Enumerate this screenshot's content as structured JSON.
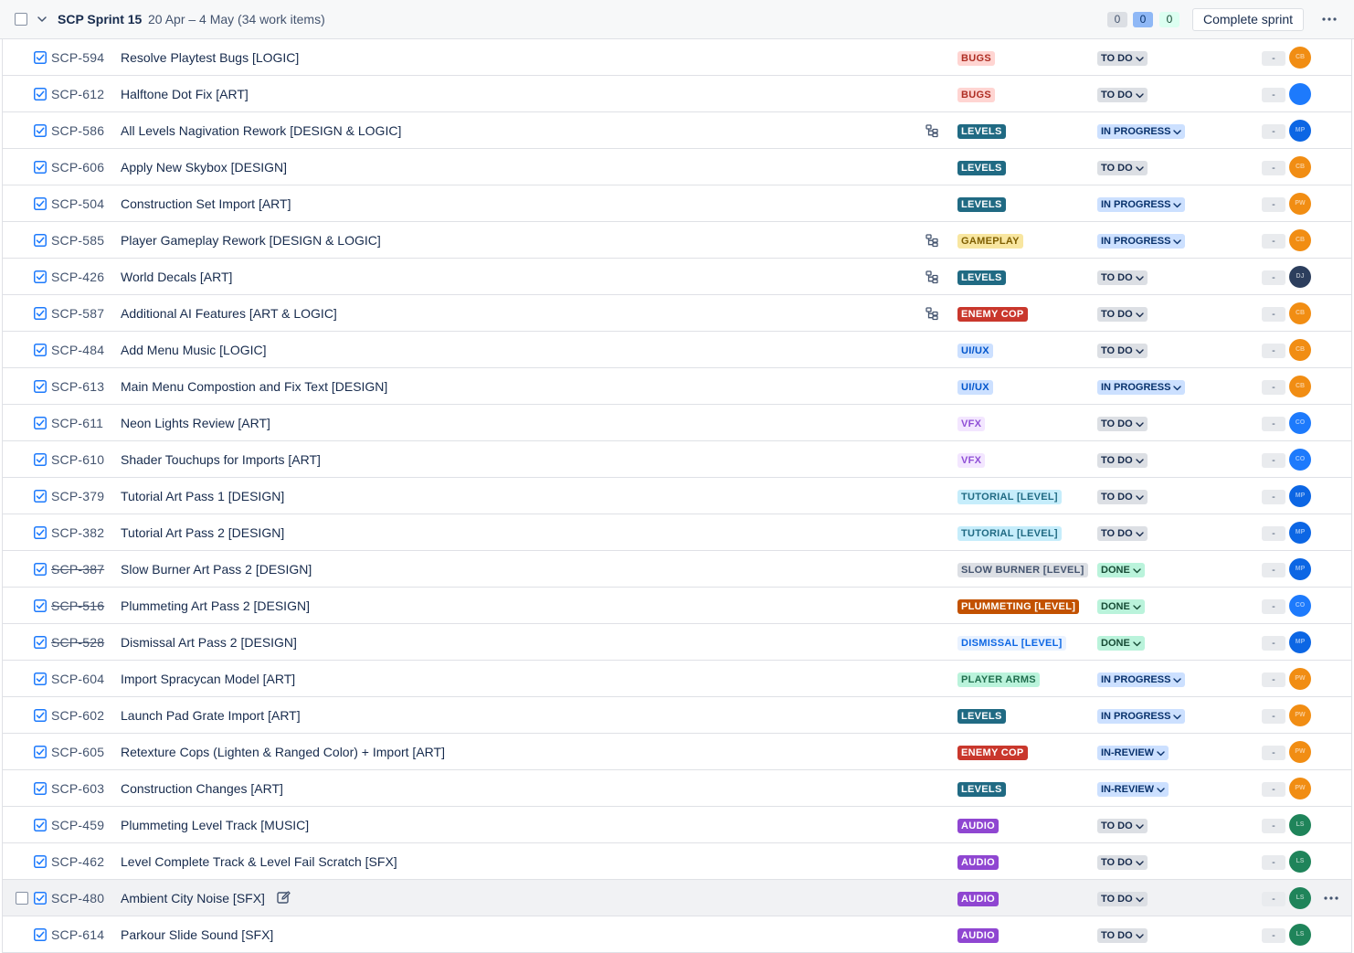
{
  "sprint": {
    "title": "SCP Sprint 15",
    "dates": "20 Apr – 4 May (34 work items)",
    "counts": {
      "todo": "0",
      "in_progress": "0",
      "done": "0"
    },
    "complete_label": "Complete sprint"
  },
  "issues": [
    {
      "key": "SCP-594",
      "summary": "Resolve Playtest Bugs [LOGIC]",
      "epic": "BUGS",
      "epic_style": "bugs",
      "status": "TO DO",
      "status_style": "todo",
      "estimate": "-",
      "avatar_color": "#f18d13",
      "avatar_text": "CB",
      "has_children": false,
      "done": false
    },
    {
      "key": "SCP-612",
      "summary": "Halftone Dot Fix [ART]",
      "epic": "BUGS",
      "epic_style": "bugs",
      "status": "TO DO",
      "status_style": "todo",
      "estimate": "-",
      "avatar_color": "#1d7afc",
      "avatar_text": "",
      "has_children": false,
      "done": false
    },
    {
      "key": "SCP-586",
      "summary": "All Levels Nagivation Rework [DESIGN & LOGIC]",
      "epic": "LEVELS",
      "epic_style": "levels",
      "status": "IN PROGRESS",
      "status_style": "progress",
      "estimate": "-",
      "avatar_color": "#0c66e4",
      "avatar_text": "MP",
      "has_children": true,
      "done": false
    },
    {
      "key": "SCP-606",
      "summary": "Apply New Skybox [DESIGN]",
      "epic": "LEVELS",
      "epic_style": "levels",
      "status": "TO DO",
      "status_style": "todo",
      "estimate": "-",
      "avatar_color": "#f18d13",
      "avatar_text": "CB",
      "has_children": false,
      "done": false
    },
    {
      "key": "SCP-504",
      "summary": "Construction Set Import [ART]",
      "epic": "LEVELS",
      "epic_style": "levels",
      "status": "IN PROGRESS",
      "status_style": "progress",
      "estimate": "-",
      "avatar_color": "#f18d13",
      "avatar_text": "PW",
      "has_children": false,
      "done": false
    },
    {
      "key": "SCP-585",
      "summary": "Player Gameplay Rework [DESIGN & LOGIC]",
      "epic": "GAMEPLAY",
      "epic_style": "gameplay",
      "status": "IN PROGRESS",
      "status_style": "progress",
      "estimate": "-",
      "avatar_color": "#f18d13",
      "avatar_text": "CB",
      "has_children": true,
      "done": false
    },
    {
      "key": "SCP-426",
      "summary": "World Decals [ART]",
      "epic": "LEVELS",
      "epic_style": "levels",
      "status": "TO DO",
      "status_style": "todo",
      "estimate": "-",
      "avatar_color": "#2c3e5d",
      "avatar_text": "DJ",
      "has_children": true,
      "done": false
    },
    {
      "key": "SCP-587",
      "summary": "Additional AI Features [ART & LOGIC]",
      "epic": "ENEMY COP",
      "epic_style": "enemy",
      "status": "TO DO",
      "status_style": "todo",
      "estimate": "-",
      "avatar_color": "#f18d13",
      "avatar_text": "CB",
      "has_children": true,
      "done": false
    },
    {
      "key": "SCP-484",
      "summary": "Add Menu Music [LOGIC]",
      "epic": "UI/UX",
      "epic_style": "uiux",
      "status": "TO DO",
      "status_style": "todo",
      "estimate": "-",
      "avatar_color": "#f18d13",
      "avatar_text": "CB",
      "has_children": false,
      "done": false
    },
    {
      "key": "SCP-613",
      "summary": "Main Menu Compostion and Fix Text [DESIGN]",
      "epic": "UI/UX",
      "epic_style": "uiux",
      "status": "IN PROGRESS",
      "status_style": "progress",
      "estimate": "-",
      "avatar_color": "#f18d13",
      "avatar_text": "CB",
      "has_children": false,
      "done": false
    },
    {
      "key": "SCP-611",
      "summary": "Neon Lights Review [ART]",
      "epic": "VFX",
      "epic_style": "vfx",
      "status": "TO DO",
      "status_style": "todo",
      "estimate": "-",
      "avatar_color": "#1d7afc",
      "avatar_text": "CO",
      "has_children": false,
      "done": false
    },
    {
      "key": "SCP-610",
      "summary": "Shader Touchups for Imports [ART]",
      "epic": "VFX",
      "epic_style": "vfx",
      "status": "TO DO",
      "status_style": "todo",
      "estimate": "-",
      "avatar_color": "#1d7afc",
      "avatar_text": "CO",
      "has_children": false,
      "done": false
    },
    {
      "key": "SCP-379",
      "summary": "Tutorial Art Pass 1 [DESIGN]",
      "epic": "TUTORIAL [LEVEL]",
      "epic_style": "tutorial",
      "status": "TO DO",
      "status_style": "todo",
      "estimate": "-",
      "avatar_color": "#0c66e4",
      "avatar_text": "MP",
      "has_children": false,
      "done": false
    },
    {
      "key": "SCP-382",
      "summary": "Tutorial Art Pass 2 [DESIGN]",
      "epic": "TUTORIAL [LEVEL]",
      "epic_style": "tutorial",
      "status": "TO DO",
      "status_style": "todo",
      "estimate": "-",
      "avatar_color": "#0c66e4",
      "avatar_text": "MP",
      "has_children": false,
      "done": false
    },
    {
      "key": "SCP-387",
      "summary": "Slow Burner Art Pass 2 [DESIGN]",
      "epic": "SLOW BURNER [LEVEL]",
      "epic_style": "slowburner",
      "status": "DONE",
      "status_style": "done",
      "estimate": "-",
      "avatar_color": "#0c66e4",
      "avatar_text": "MP",
      "has_children": false,
      "done": true
    },
    {
      "key": "SCP-516",
      "summary": "Plummeting Art Pass 2 [DESIGN]",
      "epic": "PLUMMETING [LEVEL]",
      "epic_style": "plummeting",
      "status": "DONE",
      "status_style": "done",
      "estimate": "-",
      "avatar_color": "#1d7afc",
      "avatar_text": "CO",
      "has_children": false,
      "done": true
    },
    {
      "key": "SCP-528",
      "summary": "Dismissal Art Pass 2 [DESIGN]",
      "epic": "DISMISSAL [LEVEL]",
      "epic_style": "dismissal",
      "status": "DONE",
      "status_style": "done",
      "estimate": "-",
      "avatar_color": "#0c66e4",
      "avatar_text": "MP",
      "has_children": false,
      "done": true
    },
    {
      "key": "SCP-604",
      "summary": "Import Spracycan Model [ART]",
      "epic": "PLAYER ARMS",
      "epic_style": "playerarms",
      "status": "IN PROGRESS",
      "status_style": "progress",
      "estimate": "-",
      "avatar_color": "#f18d13",
      "avatar_text": "PW",
      "has_children": false,
      "done": false
    },
    {
      "key": "SCP-602",
      "summary": "Launch Pad Grate Import [ART]",
      "epic": "LEVELS",
      "epic_style": "levels",
      "status": "IN PROGRESS",
      "status_style": "progress",
      "estimate": "-",
      "avatar_color": "#f18d13",
      "avatar_text": "PW",
      "has_children": false,
      "done": false
    },
    {
      "key": "SCP-605",
      "summary": "Retexture Cops (Lighten & Ranged Color) + Import [ART]",
      "epic": "ENEMY COP",
      "epic_style": "enemy",
      "status": "IN-REVIEW",
      "status_style": "review",
      "estimate": "-",
      "avatar_color": "#f18d13",
      "avatar_text": "PW",
      "has_children": false,
      "done": false
    },
    {
      "key": "SCP-603",
      "summary": "Construction Changes [ART]",
      "epic": "LEVELS",
      "epic_style": "levels",
      "status": "IN-REVIEW",
      "status_style": "review",
      "estimate": "-",
      "avatar_color": "#f18d13",
      "avatar_text": "PW",
      "has_children": false,
      "done": false
    },
    {
      "key": "SCP-459",
      "summary": "Plummeting Level Track [MUSIC]",
      "epic": "AUDIO",
      "epic_style": "audio",
      "status": "TO DO",
      "status_style": "todo",
      "estimate": "-",
      "avatar_color": "#1f845a",
      "avatar_text": "LS",
      "has_children": false,
      "done": false
    },
    {
      "key": "SCP-462",
      "summary": "Level Complete Track & Level Fail Scratch [SFX]",
      "epic": "AUDIO",
      "epic_style": "audio",
      "status": "TO DO",
      "status_style": "todo",
      "estimate": "-",
      "avatar_color": "#1f845a",
      "avatar_text": "LS",
      "has_children": false,
      "done": false
    },
    {
      "key": "SCP-480",
      "summary": "Ambient City Noise [SFX]",
      "epic": "AUDIO",
      "epic_style": "audio",
      "status": "TO DO",
      "status_style": "todo",
      "estimate": "-",
      "avatar_color": "#1f845a",
      "avatar_text": "LS",
      "has_children": false,
      "done": false,
      "hover": true
    },
    {
      "key": "SCP-614",
      "summary": "Parkour Slide Sound [SFX]",
      "epic": "AUDIO",
      "epic_style": "audio",
      "status": "TO DO",
      "status_style": "todo",
      "estimate": "-",
      "avatar_color": "#1f845a",
      "avatar_text": "LS",
      "has_children": false,
      "done": false
    }
  ],
  "epic_styles": {
    "bugs": {
      "bg": "#ffd5d2",
      "fg": "#ae2e24"
    },
    "levels": {
      "bg": "#206a83",
      "fg": "#ffffff"
    },
    "gameplay": {
      "bg": "#f8e6a0",
      "fg": "#7f5f01"
    },
    "enemy": {
      "bg": "#c9372c",
      "fg": "#ffffff"
    },
    "uiux": {
      "bg": "#cce0ff",
      "fg": "#0055cc"
    },
    "vfx": {
      "bg": "#f3e6ff",
      "fg": "#8f4fd6"
    },
    "tutorial": {
      "bg": "#c6edfb",
      "fg": "#206a83"
    },
    "slowburner": {
      "bg": "#dcdfe4",
      "fg": "#44546f"
    },
    "plummeting": {
      "bg": "#c25100",
      "fg": "#ffffff"
    },
    "dismissal": {
      "bg": "#e9f2ff",
      "fg": "#0c66e4"
    },
    "playerarms": {
      "bg": "#baf3db",
      "fg": "#216e4e"
    },
    "audio": {
      "bg": "#8f46d1",
      "fg": "#ffffff"
    }
  }
}
